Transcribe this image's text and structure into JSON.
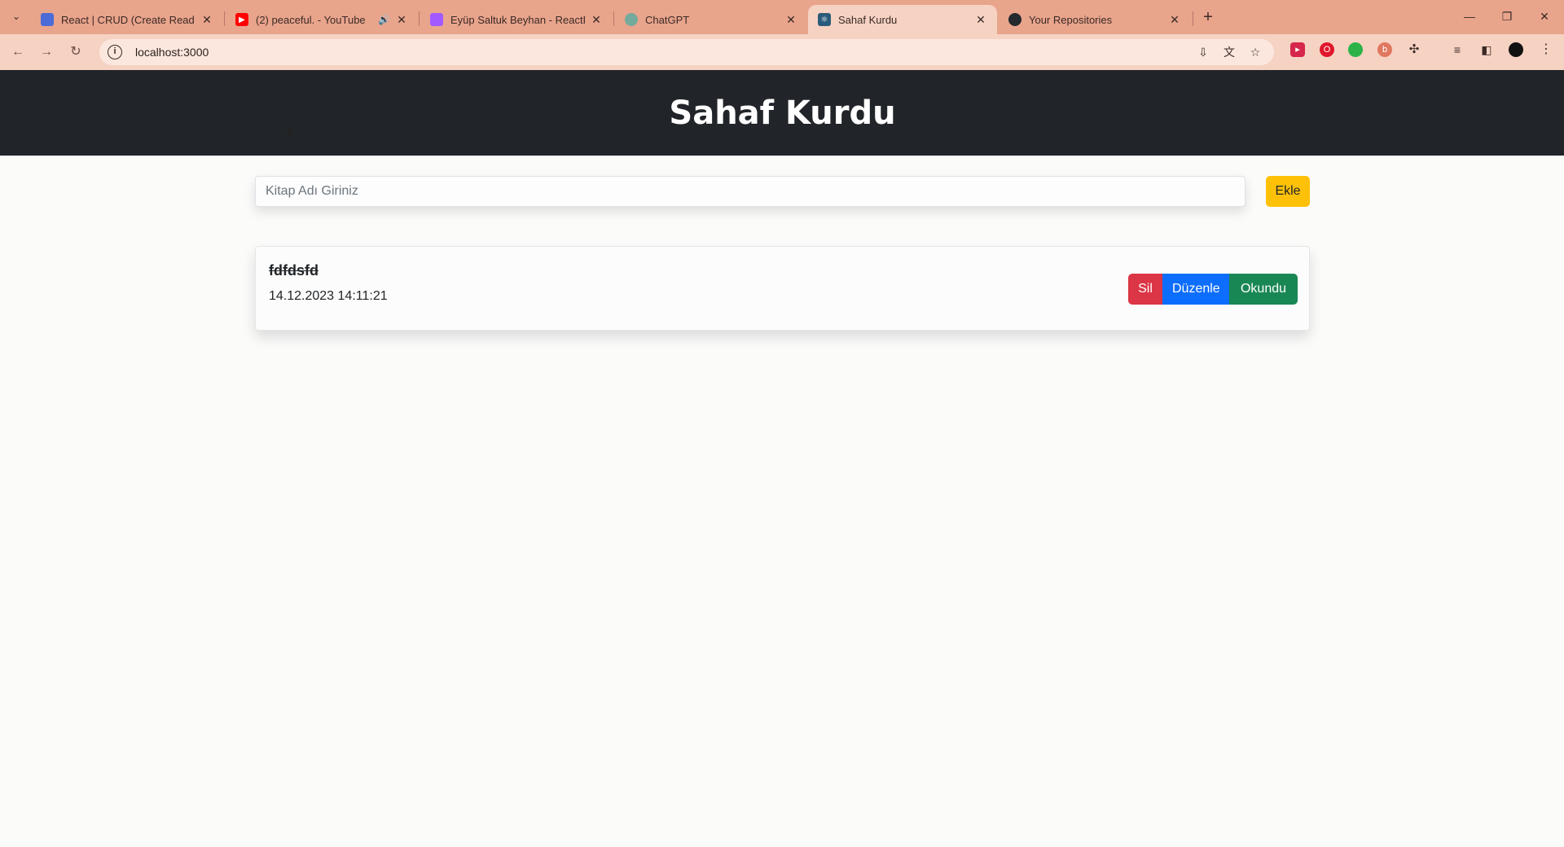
{
  "browser": {
    "tabs": [
      {
        "title": "React | CRUD (Create Read Upd",
        "favicon_color": "#4b6bd6",
        "icon": "doc-icon"
      },
      {
        "title": "(2) peaceful. - YouTube",
        "favicon_color": "#ff0000",
        "icon": "youtube-icon",
        "audio": "🔊"
      },
      {
        "title": "Eyüp Saltuk Beyhan - ReactFror",
        "favicon_color": "#a259ff",
        "icon": "figma-icon"
      },
      {
        "title": "ChatGPT",
        "favicon_color": "#74aa9c",
        "icon": "chatgpt-icon"
      },
      {
        "title": "Sahaf Kurdu",
        "favicon_color": "#2a5b7a",
        "icon": "react-icon"
      },
      {
        "title": "Your Repositories",
        "favicon_color": "#24292e",
        "icon": "github-icon"
      }
    ],
    "url": "localhost:3000",
    "accent": "#e9a48c"
  },
  "app": {
    "title": "Sahaf Kurdu",
    "input_placeholder": "Kitap Adı Giriniz",
    "add_label": "Ekle",
    "books": [
      {
        "title": "fdfdsfd",
        "date": "14.12.2023 14:11:21",
        "read": true
      }
    ],
    "actions": {
      "delete": "Sil",
      "edit": "Düzenle",
      "read": "Okundu"
    }
  }
}
